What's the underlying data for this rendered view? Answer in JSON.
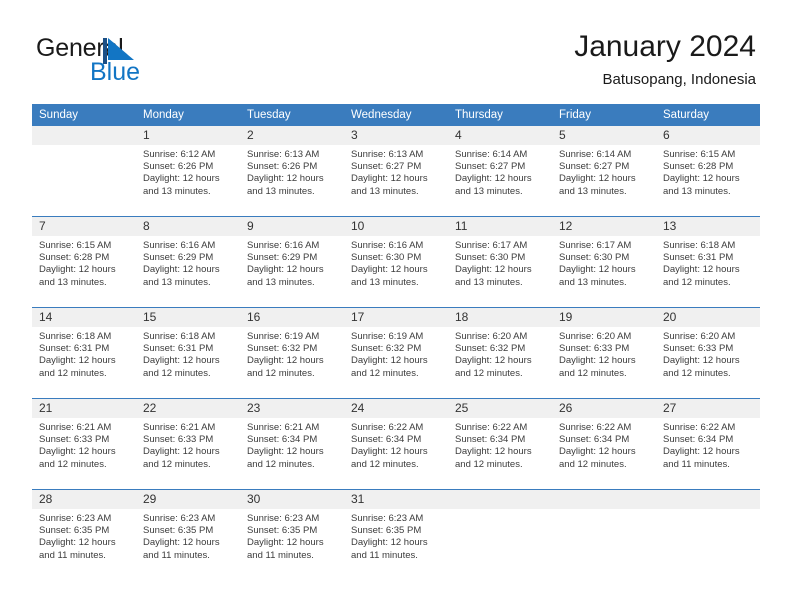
{
  "brand": {
    "name_part1": "General",
    "name_part2": "Blue",
    "flag_icon": "blue-triangle-flag-icon",
    "accent_color": "#1275c4"
  },
  "header": {
    "title": "January 2024",
    "subtitle": "Batusopang, Indonesia"
  },
  "theme": {
    "header_row_bg": "#3a7cbe",
    "day_number_bg": "#f0f0f0",
    "text_color": "#3c3c3c",
    "page_bg": "#ffffff"
  },
  "calendar": {
    "weekday_headers": [
      "Sunday",
      "Monday",
      "Tuesday",
      "Wednesday",
      "Thursday",
      "Friday",
      "Saturday"
    ],
    "labels": {
      "sunrise": "Sunrise:",
      "sunset": "Sunset:",
      "daylight": "Daylight:"
    },
    "weeks": [
      [
        {
          "day": "",
          "empty": true
        },
        {
          "day": "1",
          "sunrise": "Sunrise: 6:12 AM",
          "sunset": "Sunset: 6:26 PM",
          "daylight_line1": "Daylight: 12 hours",
          "daylight_line2": "and 13 minutes."
        },
        {
          "day": "2",
          "sunrise": "Sunrise: 6:13 AM",
          "sunset": "Sunset: 6:26 PM",
          "daylight_line1": "Daylight: 12 hours",
          "daylight_line2": "and 13 minutes."
        },
        {
          "day": "3",
          "sunrise": "Sunrise: 6:13 AM",
          "sunset": "Sunset: 6:27 PM",
          "daylight_line1": "Daylight: 12 hours",
          "daylight_line2": "and 13 minutes."
        },
        {
          "day": "4",
          "sunrise": "Sunrise: 6:14 AM",
          "sunset": "Sunset: 6:27 PM",
          "daylight_line1": "Daylight: 12 hours",
          "daylight_line2": "and 13 minutes."
        },
        {
          "day": "5",
          "sunrise": "Sunrise: 6:14 AM",
          "sunset": "Sunset: 6:27 PM",
          "daylight_line1": "Daylight: 12 hours",
          "daylight_line2": "and 13 minutes."
        },
        {
          "day": "6",
          "sunrise": "Sunrise: 6:15 AM",
          "sunset": "Sunset: 6:28 PM",
          "daylight_line1": "Daylight: 12 hours",
          "daylight_line2": "and 13 minutes."
        }
      ],
      [
        {
          "day": "7",
          "sunrise": "Sunrise: 6:15 AM",
          "sunset": "Sunset: 6:28 PM",
          "daylight_line1": "Daylight: 12 hours",
          "daylight_line2": "and 13 minutes."
        },
        {
          "day": "8",
          "sunrise": "Sunrise: 6:16 AM",
          "sunset": "Sunset: 6:29 PM",
          "daylight_line1": "Daylight: 12 hours",
          "daylight_line2": "and 13 minutes."
        },
        {
          "day": "9",
          "sunrise": "Sunrise: 6:16 AM",
          "sunset": "Sunset: 6:29 PM",
          "daylight_line1": "Daylight: 12 hours",
          "daylight_line2": "and 13 minutes."
        },
        {
          "day": "10",
          "sunrise": "Sunrise: 6:16 AM",
          "sunset": "Sunset: 6:30 PM",
          "daylight_line1": "Daylight: 12 hours",
          "daylight_line2": "and 13 minutes."
        },
        {
          "day": "11",
          "sunrise": "Sunrise: 6:17 AM",
          "sunset": "Sunset: 6:30 PM",
          "daylight_line1": "Daylight: 12 hours",
          "daylight_line2": "and 13 minutes."
        },
        {
          "day": "12",
          "sunrise": "Sunrise: 6:17 AM",
          "sunset": "Sunset: 6:30 PM",
          "daylight_line1": "Daylight: 12 hours",
          "daylight_line2": "and 13 minutes."
        },
        {
          "day": "13",
          "sunrise": "Sunrise: 6:18 AM",
          "sunset": "Sunset: 6:31 PM",
          "daylight_line1": "Daylight: 12 hours",
          "daylight_line2": "and 12 minutes."
        }
      ],
      [
        {
          "day": "14",
          "sunrise": "Sunrise: 6:18 AM",
          "sunset": "Sunset: 6:31 PM",
          "daylight_line1": "Daylight: 12 hours",
          "daylight_line2": "and 12 minutes."
        },
        {
          "day": "15",
          "sunrise": "Sunrise: 6:18 AM",
          "sunset": "Sunset: 6:31 PM",
          "daylight_line1": "Daylight: 12 hours",
          "daylight_line2": "and 12 minutes."
        },
        {
          "day": "16",
          "sunrise": "Sunrise: 6:19 AM",
          "sunset": "Sunset: 6:32 PM",
          "daylight_line1": "Daylight: 12 hours",
          "daylight_line2": "and 12 minutes."
        },
        {
          "day": "17",
          "sunrise": "Sunrise: 6:19 AM",
          "sunset": "Sunset: 6:32 PM",
          "daylight_line1": "Daylight: 12 hours",
          "daylight_line2": "and 12 minutes."
        },
        {
          "day": "18",
          "sunrise": "Sunrise: 6:20 AM",
          "sunset": "Sunset: 6:32 PM",
          "daylight_line1": "Daylight: 12 hours",
          "daylight_line2": "and 12 minutes."
        },
        {
          "day": "19",
          "sunrise": "Sunrise: 6:20 AM",
          "sunset": "Sunset: 6:33 PM",
          "daylight_line1": "Daylight: 12 hours",
          "daylight_line2": "and 12 minutes."
        },
        {
          "day": "20",
          "sunrise": "Sunrise: 6:20 AM",
          "sunset": "Sunset: 6:33 PM",
          "daylight_line1": "Daylight: 12 hours",
          "daylight_line2": "and 12 minutes."
        }
      ],
      [
        {
          "day": "21",
          "sunrise": "Sunrise: 6:21 AM",
          "sunset": "Sunset: 6:33 PM",
          "daylight_line1": "Daylight: 12 hours",
          "daylight_line2": "and 12 minutes."
        },
        {
          "day": "22",
          "sunrise": "Sunrise: 6:21 AM",
          "sunset": "Sunset: 6:33 PM",
          "daylight_line1": "Daylight: 12 hours",
          "daylight_line2": "and 12 minutes."
        },
        {
          "day": "23",
          "sunrise": "Sunrise: 6:21 AM",
          "sunset": "Sunset: 6:34 PM",
          "daylight_line1": "Daylight: 12 hours",
          "daylight_line2": "and 12 minutes."
        },
        {
          "day": "24",
          "sunrise": "Sunrise: 6:22 AM",
          "sunset": "Sunset: 6:34 PM",
          "daylight_line1": "Daylight: 12 hours",
          "daylight_line2": "and 12 minutes."
        },
        {
          "day": "25",
          "sunrise": "Sunrise: 6:22 AM",
          "sunset": "Sunset: 6:34 PM",
          "daylight_line1": "Daylight: 12 hours",
          "daylight_line2": "and 12 minutes."
        },
        {
          "day": "26",
          "sunrise": "Sunrise: 6:22 AM",
          "sunset": "Sunset: 6:34 PM",
          "daylight_line1": "Daylight: 12 hours",
          "daylight_line2": "and 12 minutes."
        },
        {
          "day": "27",
          "sunrise": "Sunrise: 6:22 AM",
          "sunset": "Sunset: 6:34 PM",
          "daylight_line1": "Daylight: 12 hours",
          "daylight_line2": "and 11 minutes."
        }
      ],
      [
        {
          "day": "28",
          "sunrise": "Sunrise: 6:23 AM",
          "sunset": "Sunset: 6:35 PM",
          "daylight_line1": "Daylight: 12 hours",
          "daylight_line2": "and 11 minutes."
        },
        {
          "day": "29",
          "sunrise": "Sunrise: 6:23 AM",
          "sunset": "Sunset: 6:35 PM",
          "daylight_line1": "Daylight: 12 hours",
          "daylight_line2": "and 11 minutes."
        },
        {
          "day": "30",
          "sunrise": "Sunrise: 6:23 AM",
          "sunset": "Sunset: 6:35 PM",
          "daylight_line1": "Daylight: 12 hours",
          "daylight_line2": "and 11 minutes."
        },
        {
          "day": "31",
          "sunrise": "Sunrise: 6:23 AM",
          "sunset": "Sunset: 6:35 PM",
          "daylight_line1": "Daylight: 12 hours",
          "daylight_line2": "and 11 minutes."
        },
        {
          "day": "",
          "empty": true
        },
        {
          "day": "",
          "empty": true
        },
        {
          "day": "",
          "empty": true
        }
      ]
    ]
  }
}
